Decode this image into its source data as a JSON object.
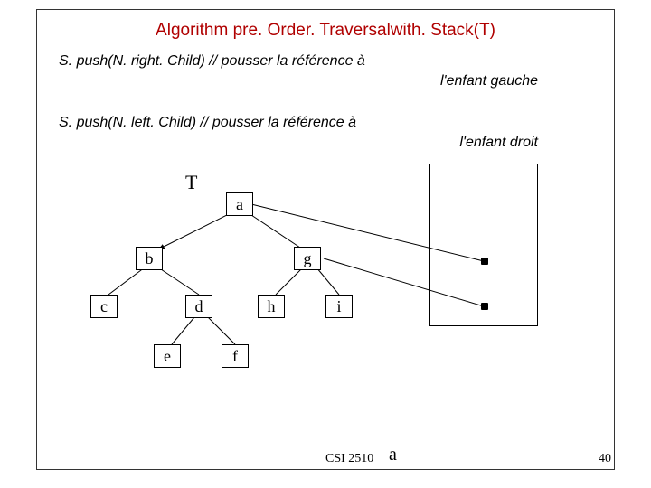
{
  "title": "Algorithm pre. Order. Traversalwith. Stack(T)",
  "lines": {
    "l1a": "S. push(N. right. Child) ",
    "l1b": "// pousser la référence à",
    "l1c": "l'enfant gauche",
    "l2a": "S. push(N. left. Child) ",
    "l2b": "// pousser la référence à",
    "l2c": "l'enfant droit"
  },
  "tree": {
    "label": "T",
    "nodes": {
      "a": "a",
      "b": "b",
      "c": "c",
      "d": "d",
      "e": "e",
      "f": "f",
      "g": "g",
      "h": "h",
      "i": "i"
    }
  },
  "stack_label": "a",
  "footer": "CSI 2510",
  "page": "40"
}
